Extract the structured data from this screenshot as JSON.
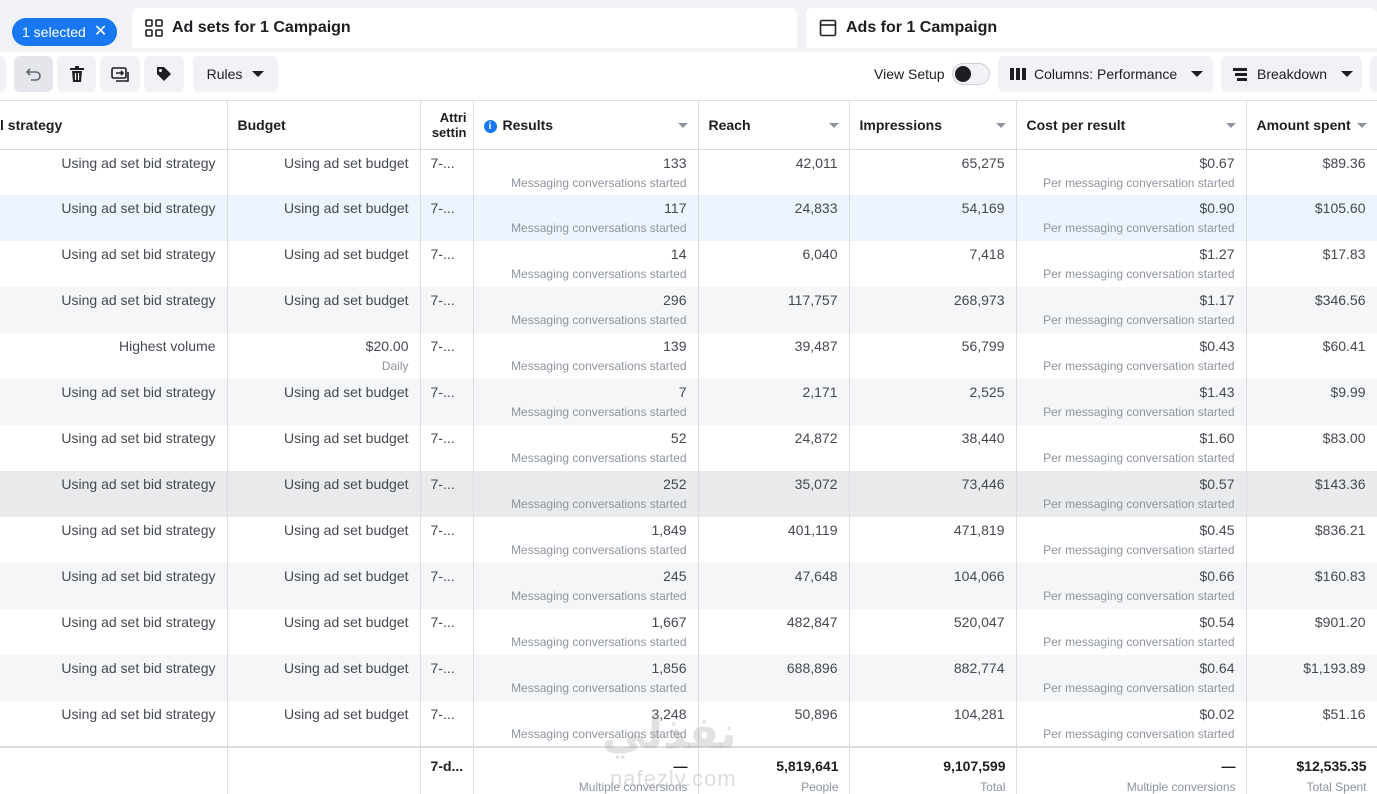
{
  "tabs": {
    "selected_label": "1 selected",
    "adsets_label": "Ad sets for 1 Campaign",
    "ads_label": "Ads for 1 Campaign"
  },
  "toolbar": {
    "rules_label": "Rules",
    "view_setup_label": "View Setup",
    "view_setup_enabled": false,
    "columns_label": "Columns: Performance",
    "breakdown_label": "Breakdown",
    "icons": [
      "undo-icon",
      "trash-icon",
      "duplicate-icon",
      "tag-icon"
    ]
  },
  "colors": {
    "accent": "#1877f2",
    "row_highlight": "#eef4fd",
    "row_alt": "#f5f6f7",
    "row_hover": "#e9eaec"
  },
  "table": {
    "headers": {
      "strategy": "l strategy",
      "budget": "Budget",
      "attribution": "Attri settin",
      "results": "Results",
      "reach": "Reach",
      "impressions": "Impressions",
      "cost_per_result": "Cost per result",
      "amount_spent": "Amount spent"
    },
    "rows": [
      {
        "strategy": "Using ad set bid strategy",
        "budget": "Using ad set budget",
        "budget_sub": "",
        "attr": "7-...",
        "results": "133",
        "results_sub": "Messaging conversations started",
        "reach": "42,011",
        "impressions": "65,275",
        "cpr": "$0.67",
        "cpr_sub": "Per messaging conversation started",
        "amount": "$89.36"
      },
      {
        "strategy": "Using ad set bid strategy",
        "budget": "Using ad set budget",
        "budget_sub": "",
        "attr": "7-...",
        "results": "117",
        "results_sub": "Messaging conversations started",
        "reach": "24,833",
        "impressions": "54,169",
        "cpr": "$0.90",
        "cpr_sub": "Per messaging conversation started",
        "amount": "$105.60"
      },
      {
        "strategy": "Using ad set bid strategy",
        "budget": "Using ad set budget",
        "budget_sub": "",
        "attr": "7-...",
        "results": "14",
        "results_sub": "Messaging conversations started",
        "reach": "6,040",
        "impressions": "7,418",
        "cpr": "$1.27",
        "cpr_sub": "Per messaging conversation started",
        "amount": "$17.83"
      },
      {
        "strategy": "Using ad set bid strategy",
        "budget": "Using ad set budget",
        "budget_sub": "",
        "attr": "7-...",
        "results": "296",
        "results_sub": "Messaging conversations started",
        "reach": "117,757",
        "impressions": "268,973",
        "cpr": "$1.17",
        "cpr_sub": "Per messaging conversation started",
        "amount": "$346.56"
      },
      {
        "strategy": "Highest volume",
        "budget": "$20.00",
        "budget_sub": "Daily",
        "attr": "7-...",
        "results": "139",
        "results_sub": "Messaging conversations started",
        "reach": "39,487",
        "impressions": "56,799",
        "cpr": "$0.43",
        "cpr_sub": "Per messaging conversation started",
        "amount": "$60.41"
      },
      {
        "strategy": "Using ad set bid strategy",
        "budget": "Using ad set budget",
        "budget_sub": "",
        "attr": "7-...",
        "results": "7",
        "results_sub": "Messaging conversations started",
        "reach": "2,171",
        "impressions": "2,525",
        "cpr": "$1.43",
        "cpr_sub": "Per messaging conversation started",
        "amount": "$9.99"
      },
      {
        "strategy": "Using ad set bid strategy",
        "budget": "Using ad set budget",
        "budget_sub": "",
        "attr": "7-...",
        "results": "52",
        "results_sub": "Messaging conversations started",
        "reach": "24,872",
        "impressions": "38,440",
        "cpr": "$1.60",
        "cpr_sub": "Per messaging conversation started",
        "amount": "$83.00"
      },
      {
        "strategy": "Using ad set bid strategy",
        "budget": "Using ad set budget",
        "budget_sub": "",
        "attr": "7-...",
        "results": "252",
        "results_sub": "Messaging conversations started",
        "reach": "35,072",
        "impressions": "73,446",
        "cpr": "$0.57",
        "cpr_sub": "Per messaging conversation started",
        "amount": "$143.36"
      },
      {
        "strategy": "Using ad set bid strategy",
        "budget": "Using ad set budget",
        "budget_sub": "",
        "attr": "7-...",
        "results": "1,849",
        "results_sub": "Messaging conversations started",
        "reach": "401,119",
        "impressions": "471,819",
        "cpr": "$0.45",
        "cpr_sub": "Per messaging conversation started",
        "amount": "$836.21"
      },
      {
        "strategy": "Using ad set bid strategy",
        "budget": "Using ad set budget",
        "budget_sub": "",
        "attr": "7-...",
        "results": "245",
        "results_sub": "Messaging conversations started",
        "reach": "47,648",
        "impressions": "104,066",
        "cpr": "$0.66",
        "cpr_sub": "Per messaging conversation started",
        "amount": "$160.83"
      },
      {
        "strategy": "Using ad set bid strategy",
        "budget": "Using ad set budget",
        "budget_sub": "",
        "attr": "7-...",
        "results": "1,667",
        "results_sub": "Messaging conversations started",
        "reach": "482,847",
        "impressions": "520,047",
        "cpr": "$0.54",
        "cpr_sub": "Per messaging conversation started",
        "amount": "$901.20"
      },
      {
        "strategy": "Using ad set bid strategy",
        "budget": "Using ad set budget",
        "budget_sub": "",
        "attr": "7-...",
        "results": "1,856",
        "results_sub": "Messaging conversations started",
        "reach": "688,896",
        "impressions": "882,774",
        "cpr": "$0.64",
        "cpr_sub": "Per messaging conversation started",
        "amount": "$1,193.89"
      },
      {
        "strategy": "Using ad set bid strategy",
        "budget": "Using ad set budget",
        "budget_sub": "",
        "attr": "7-...",
        "results": "3,248",
        "results_sub": "Messaging conversations started",
        "reach": "50,896",
        "impressions": "104,281",
        "cpr": "$0.02",
        "cpr_sub": "Per messaging conversation started",
        "amount": "$51.16"
      }
    ],
    "totals": {
      "attr": "7-d...",
      "results": "—",
      "results_sub": "Multiple conversions",
      "reach": "5,819,641",
      "reach_sub": "People",
      "impressions": "9,107,599",
      "impressions_sub": "Total",
      "cpr": "—",
      "cpr_sub": "Multiple conversions",
      "amount": "$12,535.35",
      "amount_sub": "Total Spent"
    }
  },
  "watermark": {
    "arabic": "نفذلي",
    "latin": "nafezly.com"
  }
}
